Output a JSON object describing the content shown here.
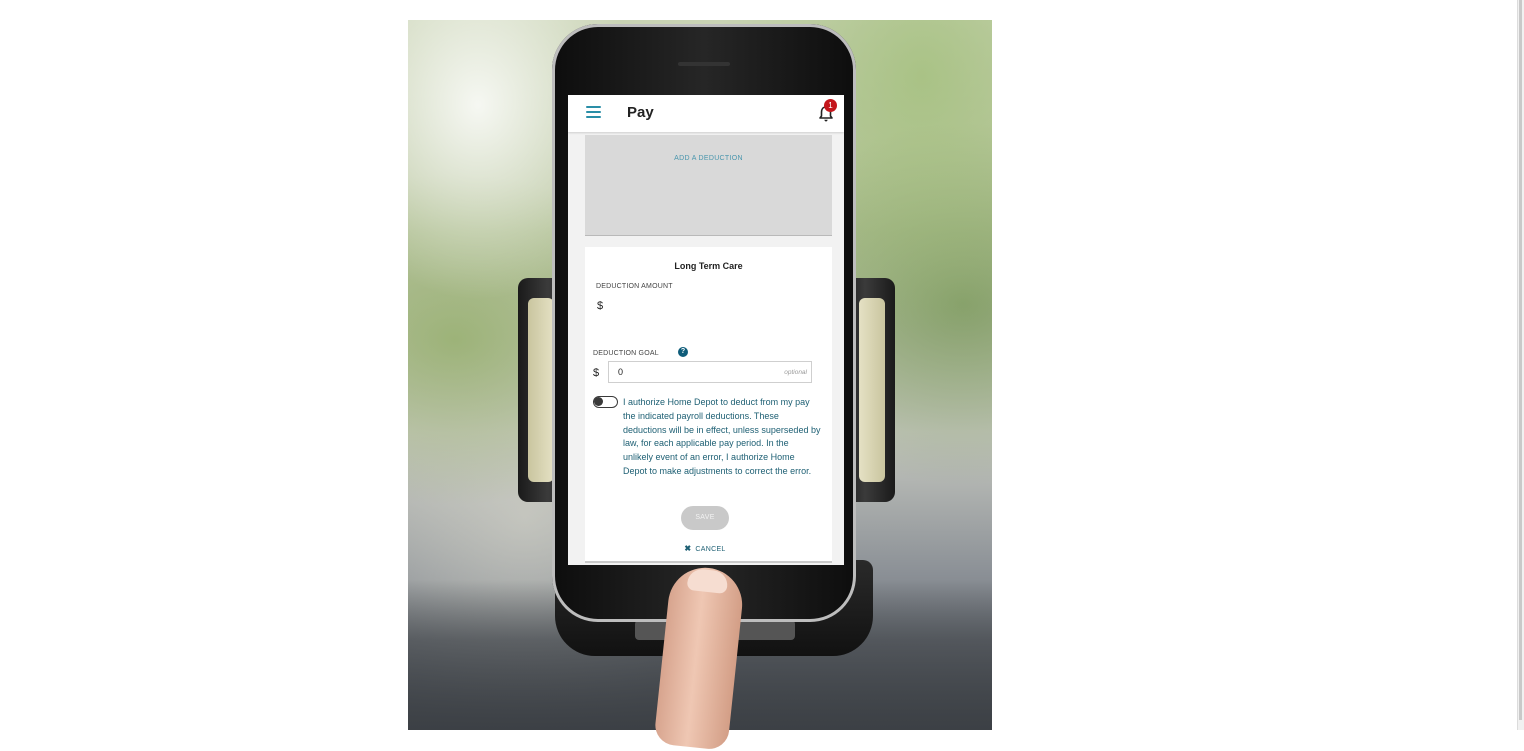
{
  "app_bar": {
    "title": "Pay",
    "notification_count": "1",
    "menu_icon": "hamburger-menu-icon",
    "bell_icon": "bell-icon"
  },
  "deductions": {
    "add_label": "ADD A DEDUCTION"
  },
  "form": {
    "title": "Long Term Care",
    "amount_label": "DEDUCTION AMOUNT",
    "amount_currency": "$",
    "amount_value": "",
    "goal_label": "DEDUCTION GOAL",
    "goal_help_icon": "question-mark-icon",
    "goal_currency": "$",
    "goal_value": "0",
    "goal_placeholder": "optional",
    "authorization_toggle_on": false,
    "authorization_text": "I authorize Home Depot to deduct from my pay the indicated payroll deductions. These deductions will be in effect, unless superseded by law, for each applicable pay period. In the unlikely event of an error, I authorize Home Depot to make adjustments to correct the error.",
    "save_label": "SAVE",
    "cancel_label": "CANCEL",
    "cancel_icon": "close-x-icon"
  },
  "colors": {
    "accent": "#2a8ea7",
    "text_teal": "#1d5f73",
    "badge_red": "#c4161c",
    "disabled_button": "#c9c9c9"
  }
}
